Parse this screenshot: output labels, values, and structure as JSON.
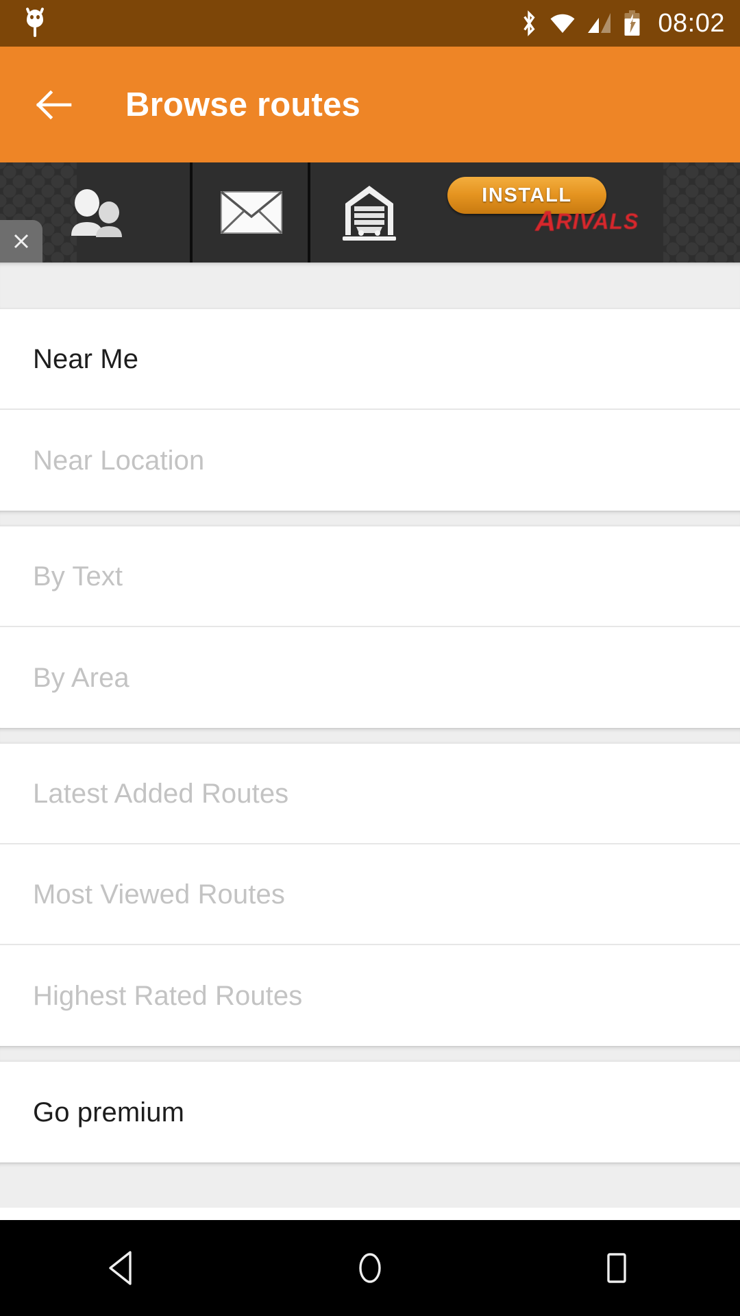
{
  "status_bar": {
    "app_icon": "owl-icon",
    "bluetooth_icon": "bluetooth-icon",
    "wifi_icon": "wifi-icon",
    "signal_icon": "cellular-signal-icon",
    "battery_icon": "battery-charging-icon",
    "time": "08:02",
    "background": "#7d4608"
  },
  "app_bar": {
    "back_icon": "back-arrow-icon",
    "title": "Browse routes",
    "background": "#ee8526"
  },
  "ad": {
    "background": "#2e2e2e",
    "icons": [
      "people-icon",
      "mail-icon",
      "garage-icon"
    ],
    "install_label": "INSTALL",
    "brand_mark": "A",
    "brand_name": "RIVALS",
    "brand_color": "#d8272c",
    "install_color": "#e59420",
    "close_icon": "close-icon"
  },
  "list": {
    "sections": [
      {
        "id": "location",
        "items": [
          {
            "label": "Near Me",
            "enabled": true,
            "name": "list-item-near-me"
          },
          {
            "label": "Near Location",
            "enabled": false,
            "name": "list-item-near-location"
          }
        ]
      },
      {
        "id": "search",
        "items": [
          {
            "label": "By Text",
            "enabled": false,
            "name": "list-item-by-text"
          },
          {
            "label": "By Area",
            "enabled": false,
            "name": "list-item-by-area"
          }
        ]
      },
      {
        "id": "routes",
        "items": [
          {
            "label": "Latest Added Routes",
            "enabled": false,
            "name": "list-item-latest-added-routes"
          },
          {
            "label": "Most Viewed Routes",
            "enabled": false,
            "name": "list-item-most-viewed-routes"
          },
          {
            "label": "Highest Rated Routes",
            "enabled": false,
            "name": "list-item-highest-rated-routes"
          }
        ]
      },
      {
        "id": "premium",
        "items": [
          {
            "label": "Go premium",
            "enabled": true,
            "name": "list-item-go-premium"
          }
        ]
      }
    ]
  },
  "nav_bar": {
    "back_icon": "nav-back-icon",
    "home_icon": "nav-home-icon",
    "recents_icon": "nav-recents-icon",
    "background": "#000000"
  }
}
